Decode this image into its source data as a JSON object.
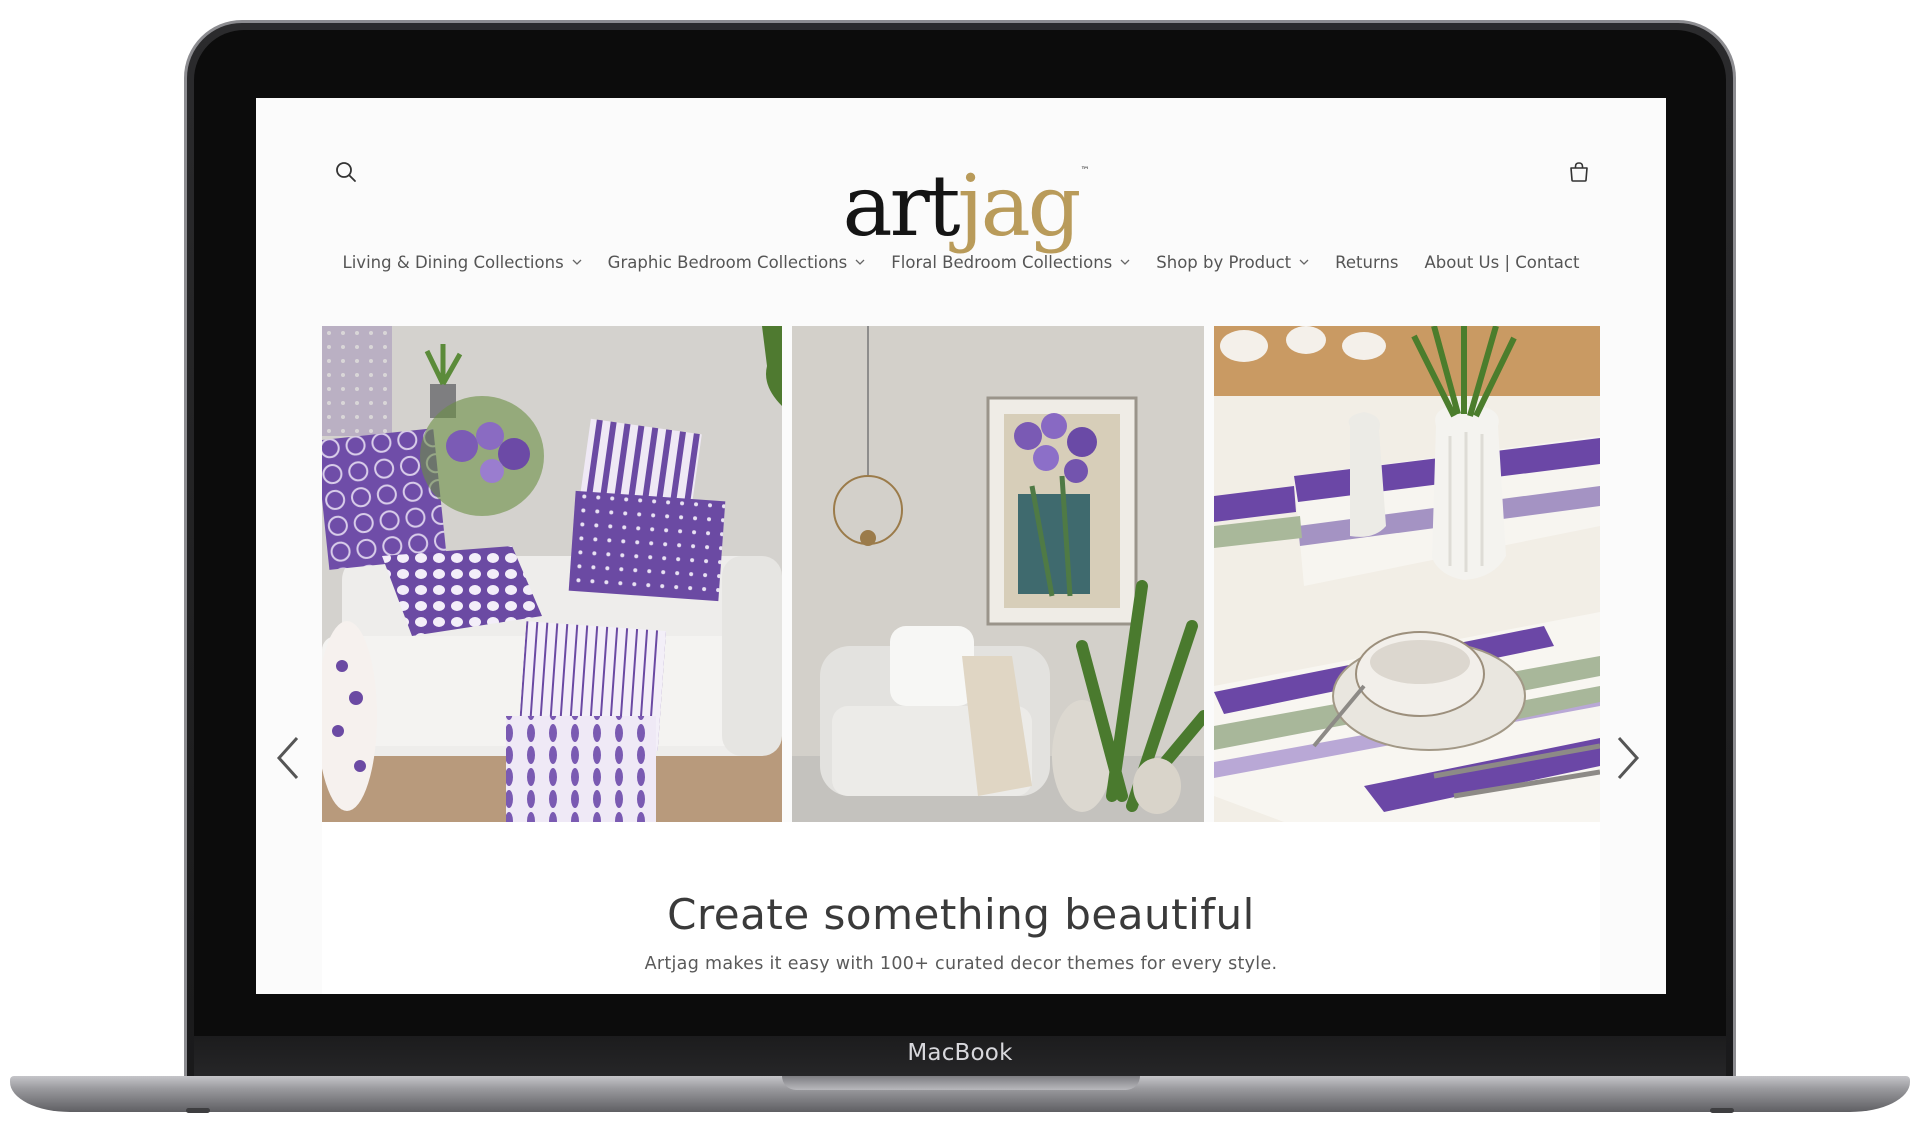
{
  "device": {
    "label": "MacBook"
  },
  "header": {
    "logo": {
      "part1": "art",
      "part2": "jag",
      "trademark": "™"
    },
    "search_icon": "search-icon",
    "cart_icon": "cart-icon"
  },
  "nav": {
    "items": [
      {
        "label": "Living & Dining Collections",
        "has_dropdown": true
      },
      {
        "label": "Graphic Bedroom Collections",
        "has_dropdown": true
      },
      {
        "label": "Floral Bedroom Collections",
        "has_dropdown": true
      },
      {
        "label": "Shop by Product",
        "has_dropdown": true
      },
      {
        "label": "Returns",
        "has_dropdown": false
      },
      {
        "label": "About Us | Contact",
        "has_dropdown": false
      }
    ]
  },
  "slideshow": {
    "prev_icon": "chevron-left-icon",
    "next_icon": "chevron-right-icon",
    "slides": [
      {
        "scene": "sofa-with-purple-pillows"
      },
      {
        "scene": "armchair-with-floral-wall-art"
      },
      {
        "scene": "dining-table-with-purple-striped-placemats"
      }
    ]
  },
  "banner": {
    "title": "Create something beautiful",
    "text": "Artjag makes it easy with 100+ curated decor themes for every style."
  },
  "colors": {
    "accent_gold": "#b99b5a",
    "accent_purple": "#6e4ca6",
    "text_primary": "#3a3a3a",
    "nav_text": "#555555"
  }
}
